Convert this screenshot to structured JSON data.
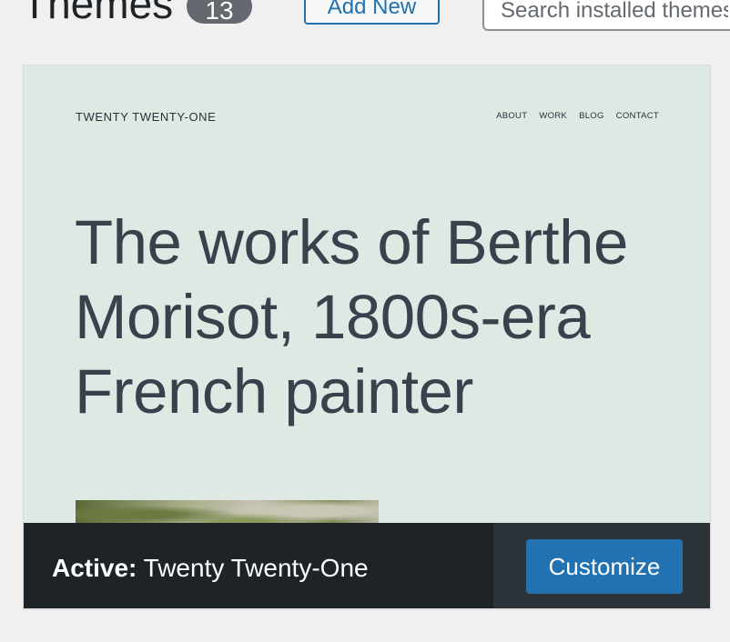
{
  "header": {
    "title": "Themes",
    "count": "13",
    "add_new_label": "Add New",
    "search_placeholder": "Search installed themes..."
  },
  "theme": {
    "screenshot": {
      "site_title": "TWENTY TWENTY-ONE",
      "nav": [
        "ABOUT",
        "WORK",
        "BLOG",
        "CONTACT"
      ],
      "headline_lines": [
        "The works of Berthe",
        "Morisot, 1800s-era",
        "French painter"
      ]
    },
    "active_prefix": "Active:",
    "name": "Twenty Twenty-One",
    "customize_label": "Customize"
  }
}
